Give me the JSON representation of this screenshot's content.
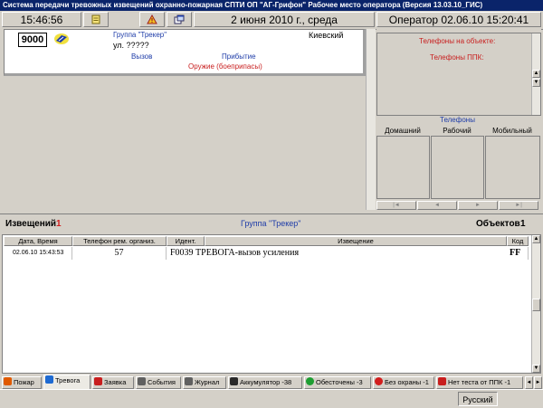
{
  "window": {
    "title": "Система передачи тревожных извещений охранно-пожарная СПТИ ОП \"АГ-Грифон\" Рабочее место оператора (Версия 13.03.10_ГИС)"
  },
  "toolbar": {
    "time": "15:46:56",
    "date": "2 июня 2010 г., среда",
    "operator": "Оператор  02.06.10 15:20:41"
  },
  "object_card": {
    "number": "9000",
    "group": "Группа \"Трекер\"",
    "district": "Киевский",
    "street": "ул. ?????",
    "call_label": "Вызов",
    "arrival_label": "Прибытие",
    "weapon_label": "Оружие (боеприпасы)"
  },
  "phones_panel": {
    "on_object_label": "Телефоны на объекте:",
    "ppk_label": "Телефоны ППК:",
    "phones_title": "Телефоны",
    "columns": [
      "Домашний",
      "Рабочий",
      "Мобильный"
    ]
  },
  "status": {
    "notices_label": "Извещений",
    "notices_count": "1",
    "group_name": "Группа \"Трекер\"",
    "objects_label": "Объектов",
    "objects_count": "1"
  },
  "table": {
    "headers": [
      "Дата, Время",
      "Телефон рем. организ.",
      "Идент.",
      "Извещение",
      "Код"
    ],
    "rows": [
      [
        "02.06.10 15:43:53",
        "57",
        "F0039 ТРЕВОГА-вызов усиления",
        "",
        "FF"
      ]
    ]
  },
  "tabs": [
    {
      "label": "Пожар",
      "icon": "fire-icon",
      "color": "#e05a00"
    },
    {
      "label": "Тревога",
      "icon": "alarm-icon",
      "color": "#1e6ad2"
    },
    {
      "label": "Заявка",
      "icon": "request-icon",
      "color": "#c81e1e"
    },
    {
      "label": "События",
      "icon": "events-icon",
      "color": "#606060"
    },
    {
      "label": "Журнал",
      "icon": "journal-icon",
      "color": "#606060"
    },
    {
      "label": "Аккумулятор -38",
      "icon": "battery-icon",
      "color": "#2a2a2a"
    },
    {
      "label": "Обесточены -3",
      "icon": "power-off-icon",
      "color": "#1e9e32"
    },
    {
      "label": "Без охраны -1",
      "icon": "unguarded-icon",
      "color": "#d21e1e"
    },
    {
      "label": "Нет теста от ППК -1",
      "icon": "phone-icon",
      "color": "#c81e1e"
    }
  ],
  "language": "Русский"
}
